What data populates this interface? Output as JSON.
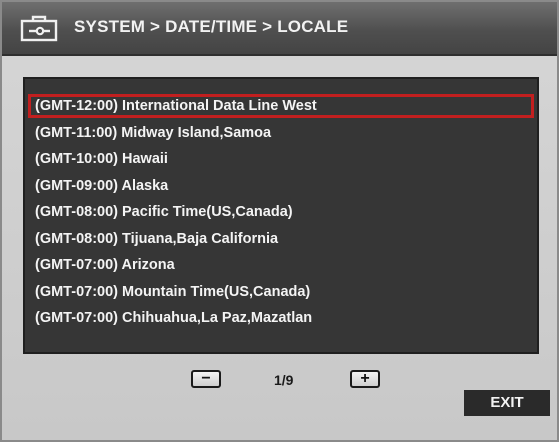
{
  "header": {
    "title": "SYSTEM > DATE/TIME > LOCALE",
    "icon": "toolbox-icon"
  },
  "timezones": [
    "(GMT-12:00) International Data Line West",
    "(GMT-11:00) Midway Island,Samoa",
    "(GMT-10:00) Hawaii",
    "(GMT-09:00) Alaska",
    "(GMT-08:00) Pacific Time(US,Canada)",
    "(GMT-08:00) Tijuana,Baja California",
    "(GMT-07:00) Arizona",
    "(GMT-07:00) Mountain Time(US,Canada)",
    "(GMT-07:00) Chihuahua,La Paz,Mazatlan"
  ],
  "selected_index": 0,
  "pager": {
    "prev_label": "−",
    "next_label": "+",
    "page": "1/9"
  },
  "exit_label": "EXIT",
  "colors": {
    "selection": "#c21f1f",
    "list_bg": "#363636"
  }
}
